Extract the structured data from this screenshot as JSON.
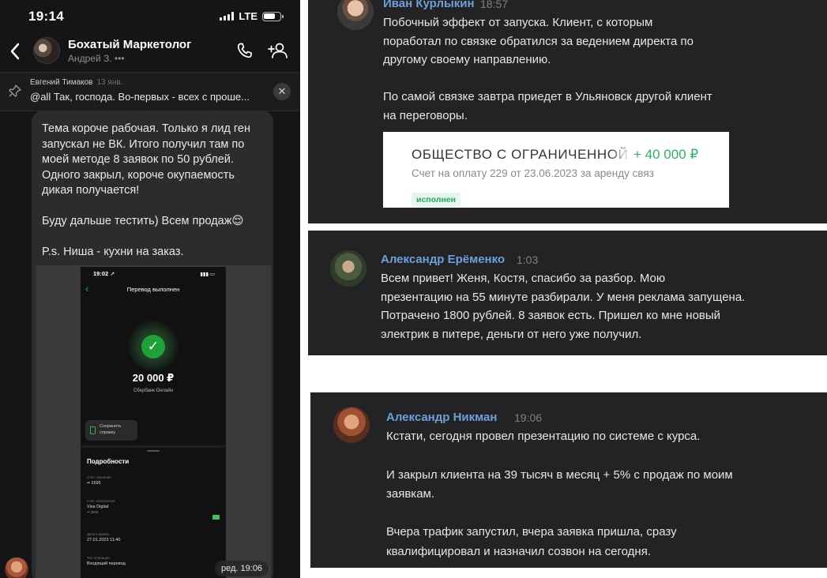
{
  "phone": {
    "status_time": "19:14",
    "network": "LTE",
    "header": {
      "title": "Бохатый Маркетолог",
      "subtitle": "Андрей З. •••"
    },
    "pinned": {
      "author": "Евгений Тимаков",
      "date": "13 янв.",
      "text": "@all Так, господа. Во-первых - всех с проше..."
    },
    "message": {
      "text": "Тема короче рабочая. Только я лид ген\nзапускал не ВК. Итого получил там по\nмоей методе 8 заявок по 50 рублей.\nОдного закрыл, короче окупаемость\nдикая получается!\n\nБуду дальше тестить) Всем продаж😌\n\nP.s. Ниша - кухни на заказ.",
      "time_badge": "ред. 19:06"
    },
    "inner_screenshot": {
      "time": "19:02 ➚",
      "title": "Перевод выполнен",
      "amount": "20 000 ₽",
      "bank": "Сбербанк Онлайн",
      "save_label": "Сохранить справку",
      "details_title": "Подробности",
      "fields": [
        {
          "label": "Счёт списания",
          "value": "•• 1695",
          "sub": ""
        },
        {
          "label": "Счёт зачисления",
          "value": "Visa Digital",
          "sub": "•• 3666"
        },
        {
          "label": "Дата и время",
          "value": "27.01.2023 11:40",
          "sub": ""
        },
        {
          "label": "Тип операции",
          "value": "Входящий перевод",
          "sub": ""
        }
      ]
    }
  },
  "panels": [
    {
      "author": "Иван Курлыкин",
      "time": "18:57",
      "text": "Побочный эффект от запуска. Клиент, с которым\nпоработал по связке обратился за ведением директа по\nдругому своему направлению.\n\nПо самой связке завтра приедет в Ульяновск другой клиент\nна переговоры.",
      "document": {
        "title": "ОБЩЕСТВО С ОГРАНИЧЕННОЙ ОТВЕ",
        "amount": "+ 40 000 ₽",
        "subtitle": "Счет на оплату 229 от 23.06.2023 за аренду связ",
        "badge": "исполнен"
      }
    },
    {
      "author": "Александр Ерёменко",
      "time": "1:03",
      "text": "Всем привет! Женя, Костя, спасибо за разбор. Мою\nпрезентацию на 55 минуте разбирали. У меня реклама запущена.\nПотрачено 1800 рублей. 8 заявок есть. Пришел ко мне новый\nэлектрик в питере, деньги от него уже получил."
    },
    {
      "author": "Александр Никман",
      "time": "19:06",
      "text": "Кстати, сегодня провел презентацию по системе с курса.\n\nИ закрыл клиента на 39 тысяч в месяц + 5% с продаж по моим\nзаявкам.\n\nВчера трафик запустил, вчера заявка пришла, сразу\nквалифицировал и назначил созвон на сегодня."
    }
  ],
  "colors": {
    "phone_bg": "#151517",
    "panel_bg": "#232325",
    "author_name": "#6f9fd8",
    "sber_green": "#21a038",
    "amount_green": "#2fb064"
  },
  "icons": [
    "back-chevron-icon",
    "phone-call-icon",
    "add-user-icon",
    "pin-icon",
    "close-icon",
    "checkmark-icon",
    "document-icon",
    "card-icon"
  ]
}
